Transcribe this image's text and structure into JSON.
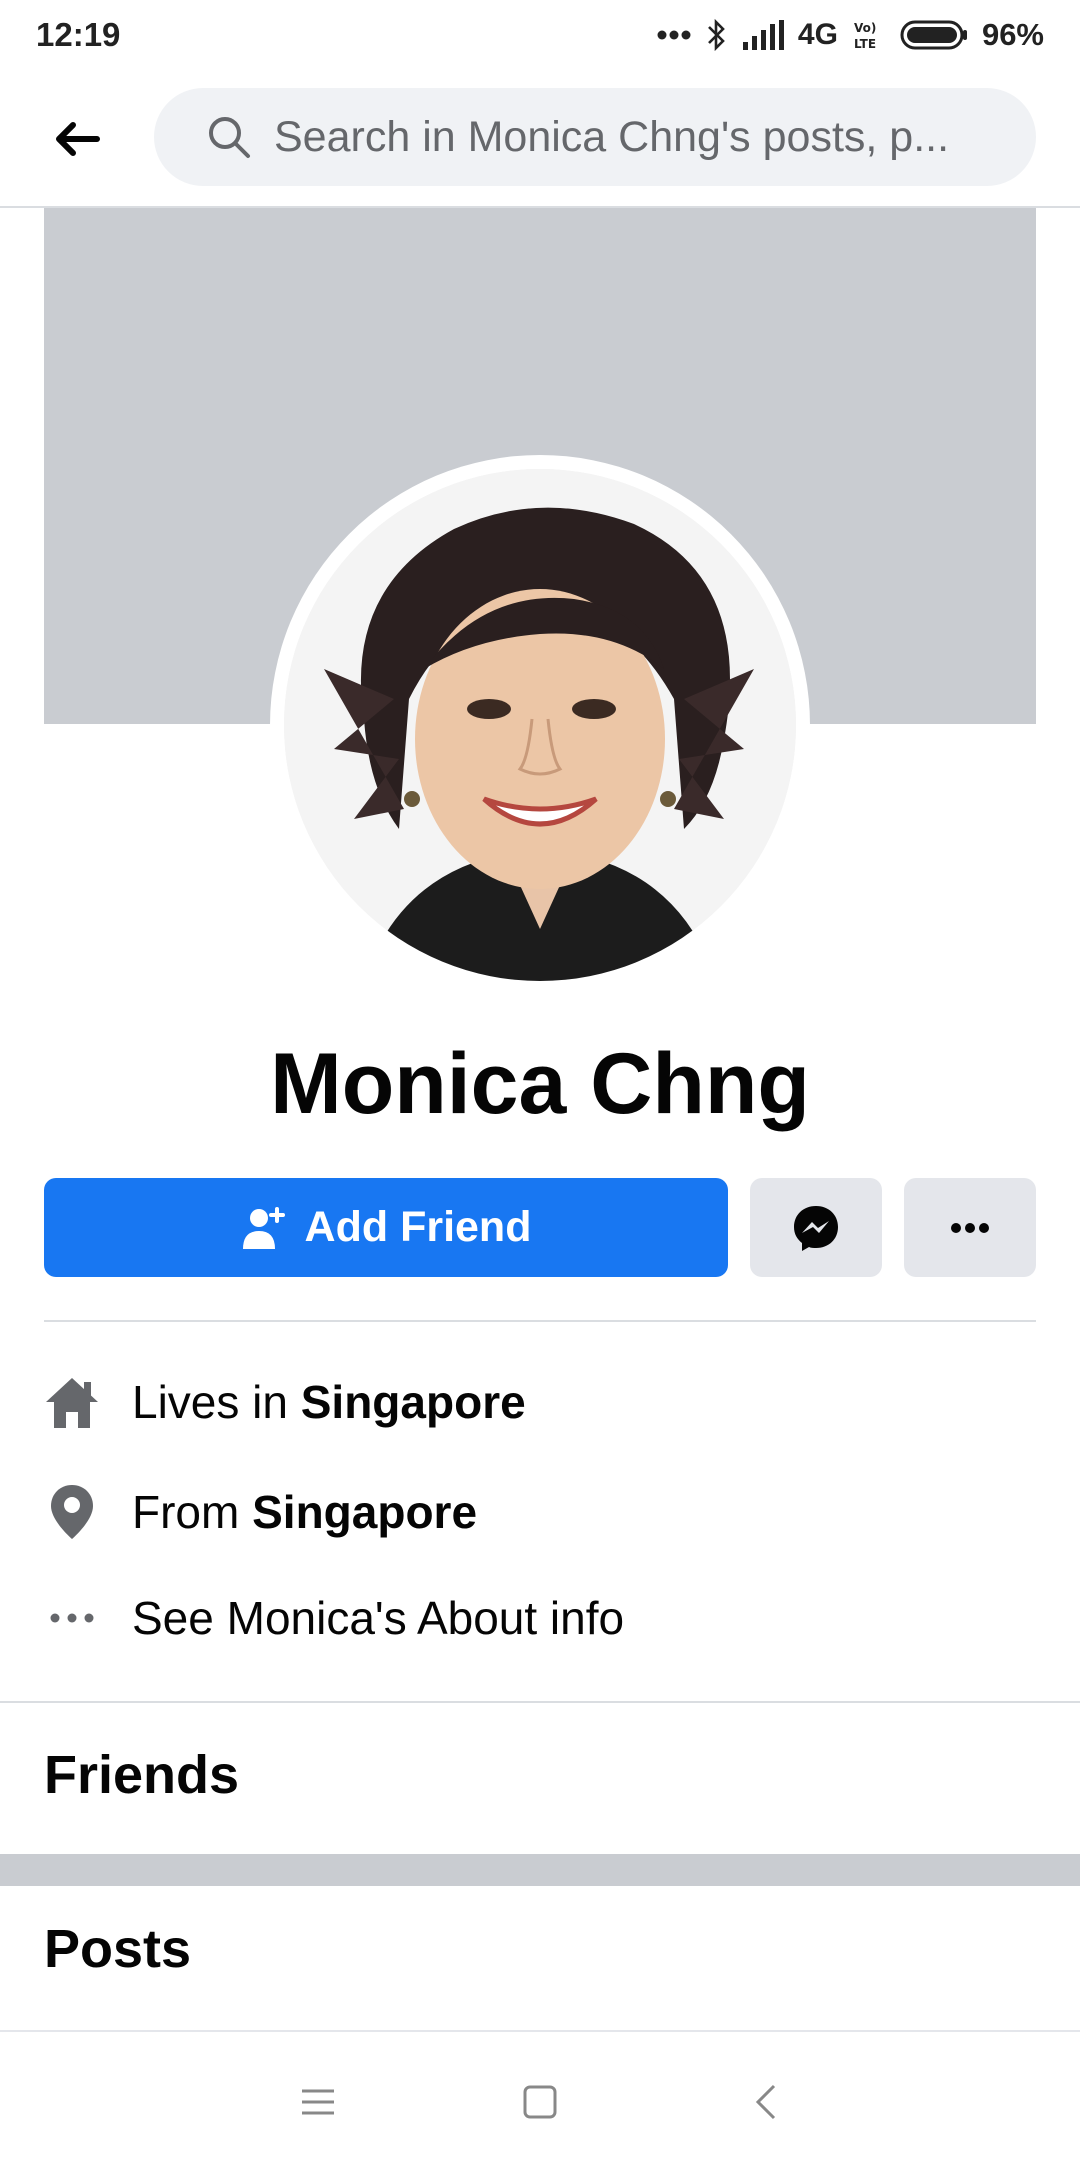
{
  "status_bar": {
    "time": "12:19",
    "network": "4G",
    "battery": "96%"
  },
  "header": {
    "search_placeholder": "Search in Monica Chng's posts, p..."
  },
  "profile": {
    "name": "Monica Chng"
  },
  "actions": {
    "add_friend_label": "Add Friend"
  },
  "info": {
    "lives_prefix": "Lives in ",
    "lives_value": "Singapore",
    "from_prefix": "From ",
    "from_value": "Singapore",
    "about_label": "See Monica's About info"
  },
  "sections": {
    "friends": "Friends",
    "posts": "Posts"
  },
  "colors": {
    "brand_blue": "#1877f2",
    "cover_gray": "#c9ccd1",
    "button_gray": "#e4e6eb"
  },
  "icons": {
    "back": "arrow-left-icon",
    "search": "search-icon",
    "add_friend": "person-add-icon",
    "messenger": "messenger-icon",
    "more": "more-dots-icon",
    "home": "home-icon",
    "location": "location-pin-icon",
    "about": "dots-icon"
  }
}
